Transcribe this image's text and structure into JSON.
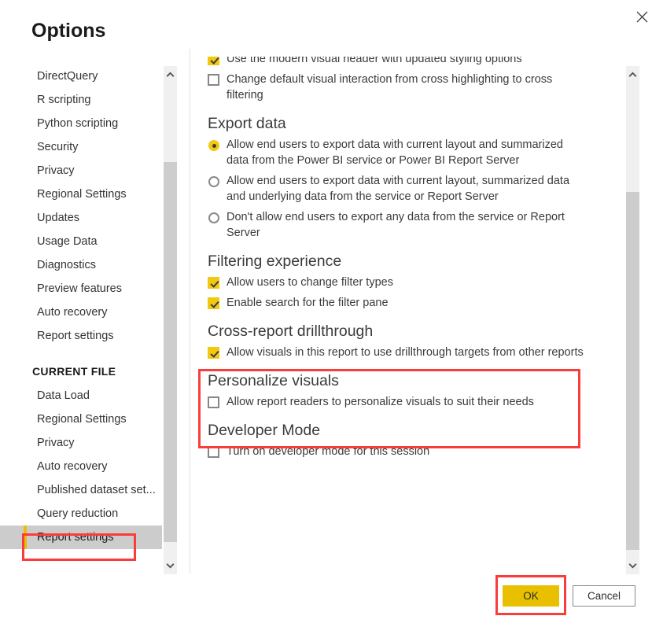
{
  "dialog": {
    "title": "Options",
    "close_icon": "close-icon"
  },
  "sidebar": {
    "global_items": [
      {
        "label": "DirectQuery",
        "selected": false
      },
      {
        "label": "R scripting",
        "selected": false
      },
      {
        "label": "Python scripting",
        "selected": false
      },
      {
        "label": "Security",
        "selected": false
      },
      {
        "label": "Privacy",
        "selected": false
      },
      {
        "label": "Regional Settings",
        "selected": false
      },
      {
        "label": "Updates",
        "selected": false
      },
      {
        "label": "Usage Data",
        "selected": false
      },
      {
        "label": "Diagnostics",
        "selected": false
      },
      {
        "label": "Preview features",
        "selected": false
      },
      {
        "label": "Auto recovery",
        "selected": false
      },
      {
        "label": "Report settings",
        "selected": false
      }
    ],
    "current_file_heading": "CURRENT FILE",
    "current_file_items": [
      {
        "label": "Data Load",
        "selected": false
      },
      {
        "label": "Regional Settings",
        "selected": false
      },
      {
        "label": "Privacy",
        "selected": false
      },
      {
        "label": "Auto recovery",
        "selected": false
      },
      {
        "label": "Published dataset set...",
        "selected": false
      },
      {
        "label": "Query reduction",
        "selected": false
      },
      {
        "label": "Report settings",
        "selected": true
      }
    ]
  },
  "content": {
    "clipped_top_option": {
      "label": "Use the modern visual header with updated styling options",
      "control": "checkbox",
      "checked": true
    },
    "visual_options": [
      {
        "label": "Change default visual interaction from cross highlighting to cross filtering",
        "control": "checkbox",
        "checked": false
      }
    ],
    "sections": [
      {
        "title": "Export data",
        "control_type": "radio",
        "options": [
          {
            "label": "Allow end users to export data with current layout and summarized data from the Power BI service or Power BI Report Server",
            "checked": true
          },
          {
            "label": "Allow end users to export data with current layout, summarized data and underlying data from the service or Report Server",
            "checked": false
          },
          {
            "label": "Don't allow end users to export any data from the service or Report Server",
            "checked": false
          }
        ]
      },
      {
        "title": "Filtering experience",
        "control_type": "checkbox",
        "options": [
          {
            "label": "Allow users to change filter types",
            "checked": true
          },
          {
            "label": "Enable search for the filter pane",
            "checked": true
          }
        ]
      },
      {
        "title": "Cross-report drillthrough",
        "control_type": "checkbox",
        "highlighted": true,
        "options": [
          {
            "label": "Allow visuals in this report to use drillthrough targets from other reports",
            "checked": true
          }
        ]
      },
      {
        "title": "Personalize visuals",
        "control_type": "checkbox",
        "options": [
          {
            "label": "Allow report readers to personalize visuals to suit their needs",
            "checked": false
          }
        ]
      },
      {
        "title": "Developer Mode",
        "control_type": "checkbox",
        "options": [
          {
            "label": "Turn on developer mode for this session",
            "checked": false
          }
        ]
      }
    ]
  },
  "footer": {
    "ok_label": "OK",
    "cancel_label": "Cancel"
  },
  "scrollbars": {
    "up_arrow_icon": "chevron-up-icon",
    "down_arrow_icon": "chevron-down-icon"
  },
  "colors": {
    "accent_yellow": "#F2C811",
    "button_yellow": "#E8C000",
    "annotation_red": "#FA3C3C",
    "text": "#3B3B3B",
    "selected_row_bg": "#CCCCCC"
  }
}
